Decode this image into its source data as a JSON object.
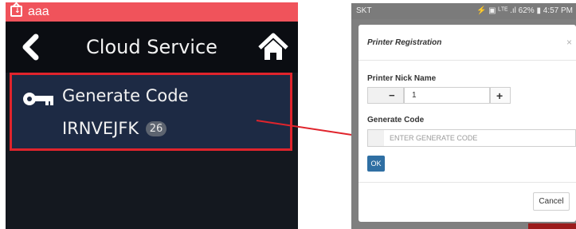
{
  "left_panel": {
    "status_user": "aaa",
    "title": "Cloud Service",
    "item_label": "Generate Code",
    "code": "IRNVEJFK",
    "code_badge": "26",
    "status_icon": "printer-status-icon",
    "back_icon": "chevron-left-icon",
    "home_icon": "home-icon",
    "key_icon": "key-icon",
    "header_color": "#f0535b",
    "highlight_color": "#e0242c"
  },
  "phone": {
    "carrier": "SKT",
    "status_right": "⚡ ▣ ᴸᵀᴱ .ıl 62% ▮ 4:57 PM",
    "modal": {
      "title": "Printer Registration",
      "close": "×",
      "nick_label": "Printer Nick Name",
      "minus": "−",
      "quantity": "1",
      "plus": "+",
      "code_label": "Generate Code",
      "code_placeholder": "ENTER GENERATE CODE",
      "ok": "OK",
      "cancel": "Cancel"
    }
  },
  "colors": {
    "arrow": "#e0242c",
    "ok_button": "#2f6fa3"
  }
}
